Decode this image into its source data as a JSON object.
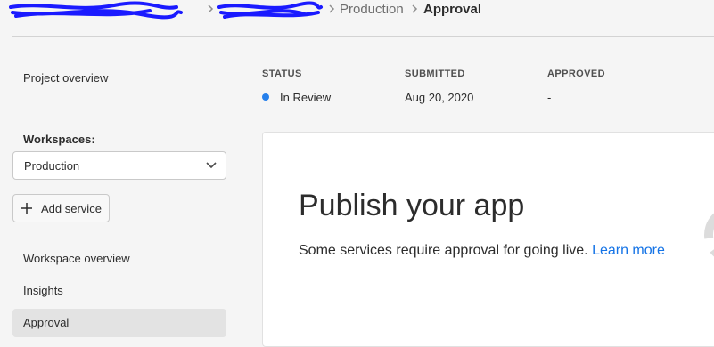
{
  "breadcrumb": {
    "items": [
      "Production",
      "Approval"
    ]
  },
  "sidebar": {
    "project_overview": "Project overview",
    "workspaces_label": "Workspaces:",
    "workspace_selected": "Production",
    "add_service": "Add service",
    "nav": [
      {
        "label": "Workspace overview"
      },
      {
        "label": "Insights"
      },
      {
        "label": "Approval",
        "selected": true
      }
    ]
  },
  "status": {
    "status_label": "STATUS",
    "status_value": "In Review",
    "status_color": "#2680eb",
    "submitted_label": "SUBMITTED",
    "submitted_value": "Aug 20, 2020",
    "approved_label": "APPROVED",
    "approved_value": "-"
  },
  "card": {
    "title": "Publish your app",
    "text": "Some services require approval for going live.",
    "link": "Learn more"
  },
  "colors": {
    "accent": "#1473e6",
    "redaction": "#1a1aff"
  }
}
